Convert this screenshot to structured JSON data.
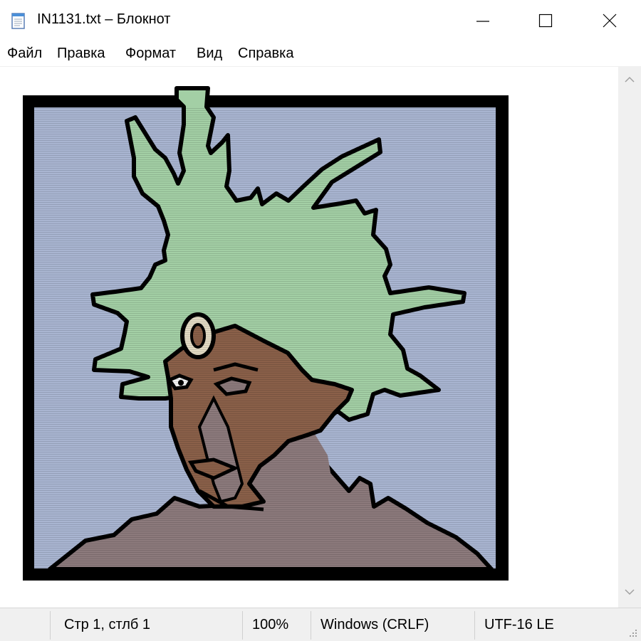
{
  "window": {
    "title": "IN1131.txt – Блокнот",
    "controls": {
      "minimize": "minimize",
      "maximize": "maximize",
      "close": "close"
    }
  },
  "menu": {
    "items": [
      "Файл",
      "Правка",
      "Формат",
      "Вид",
      "Справка"
    ]
  },
  "editor": {
    "content_type": "ascii-art portrait",
    "colors": {
      "background": "#a9b5d1",
      "hair": "#a3cfa5",
      "skin": "#8a6049",
      "body": "#8c7a7c",
      "outline": "#000000",
      "ring": "#e3dbc4"
    }
  },
  "status": {
    "position": "Стр 1, стлб 1",
    "zoom": "100%",
    "line_endings": "Windows (CRLF)",
    "encoding": "UTF-16 LE"
  },
  "icons": {
    "app": "notepad-icon",
    "scroll_up": "chevron-up-icon",
    "scroll_down": "chevron-down-icon",
    "grip": "resize-grip-icon"
  }
}
